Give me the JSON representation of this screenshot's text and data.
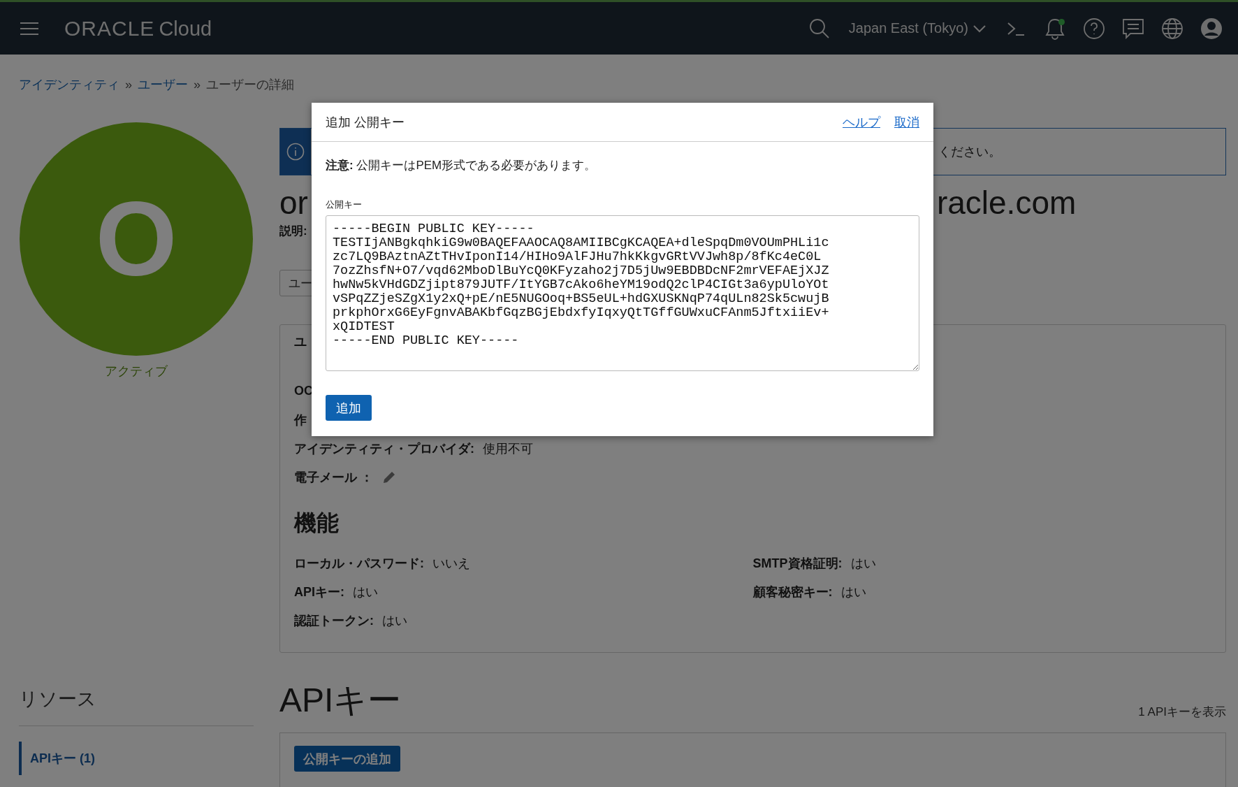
{
  "top_bar": {
    "logo": {
      "brand": "ORACLE",
      "product": "Cloud"
    },
    "region": "Japan East (Tokyo)",
    "notifications_unread": true
  },
  "breadcrumb": [
    {
      "label": "アイデンティティ",
      "link": true,
      "separator": "»"
    },
    {
      "label": "ユーザー",
      "link": true,
      "separator": "»"
    },
    {
      "label": "ユーザーの詳細",
      "link": false
    }
  ],
  "user": {
    "avatar_letter": "O",
    "status": "アクティブ"
  },
  "banner": {
    "text": "ください。"
  },
  "title_fragments": [
    "or",
    "racle.com"
  ],
  "description_label": "説明:",
  "tab_button": "ユー",
  "details": {
    "heading": "ユ",
    "fields": [
      {
        "label": "OC",
        "kind": "text"
      },
      {
        "label": "作",
        "kind": "text"
      },
      {
        "label": "アイデンティティ・プロバイダ:",
        "value": "使用不可",
        "kind": "text"
      },
      {
        "label": "電子メール ：",
        "kind": "edit"
      }
    ]
  },
  "capabilities": {
    "heading": "機能",
    "items": [
      {
        "label": "ローカル・パスワード:",
        "value": "いいえ"
      },
      {
        "label": "SMTP資格証明:",
        "value": "はい"
      },
      {
        "label": "APIキー:",
        "value": "はい"
      },
      {
        "label": "顧客秘密キー:",
        "value": "はい"
      },
      {
        "label": "認証トークン:",
        "value": "はい"
      }
    ]
  },
  "resources": {
    "heading": "リソース",
    "items": [
      {
        "label": "APIキー (1)",
        "selected": true
      }
    ]
  },
  "api_keys": {
    "heading": "APIキー",
    "count": "1 APIキーを表示",
    "add_button": "公開キーの追加"
  },
  "dialog": {
    "title": "追加 公開キー",
    "links": [
      "ヘルプ",
      "取消"
    ],
    "note": "**注意:** 公開キーはPEM形式である必要があります。",
    "field": {
      "label": "公開キー",
      "value": "-----BEGIN PUBLIC KEY-----\nTESTIjANBgkqhkiG9w0BAQEFAAOCAQ8AMIIBCgKCAQEA+dleSpqDm0VOUmPHLi1c\nzc7LQ9BAztnAZtTHvIponI14/HIHo9AlFJHu7hkKkgvGRtVVJwh8p/8fKc4eC0L\n7ozZhsfN+O7/vqd62MboDlBuYcQ0KFyzaho2j7D5jUw9EBDBDcNF2mrVEFAEjXJZ\nhwNw5kVHdGDZjipt879JUTF/ItYGB7cAko6heYM19odQ2clP4CIGt3a6ypUloYOt\nvSPqZZjeSZgX1y2xQ+pE/nE5NUGOoq+BS5eUL+hdGXUSKNqP74qULn82Sk5cwujB\nprkphOrxG6EyFgnvABAKbfGqzBGjEbdxfyIqxyQtTGffGUWxuCFAnm5JftxiiEv+\nxQIDTEST\n-----END PUBLIC KEY-----"
    },
    "submit": "追加"
  }
}
